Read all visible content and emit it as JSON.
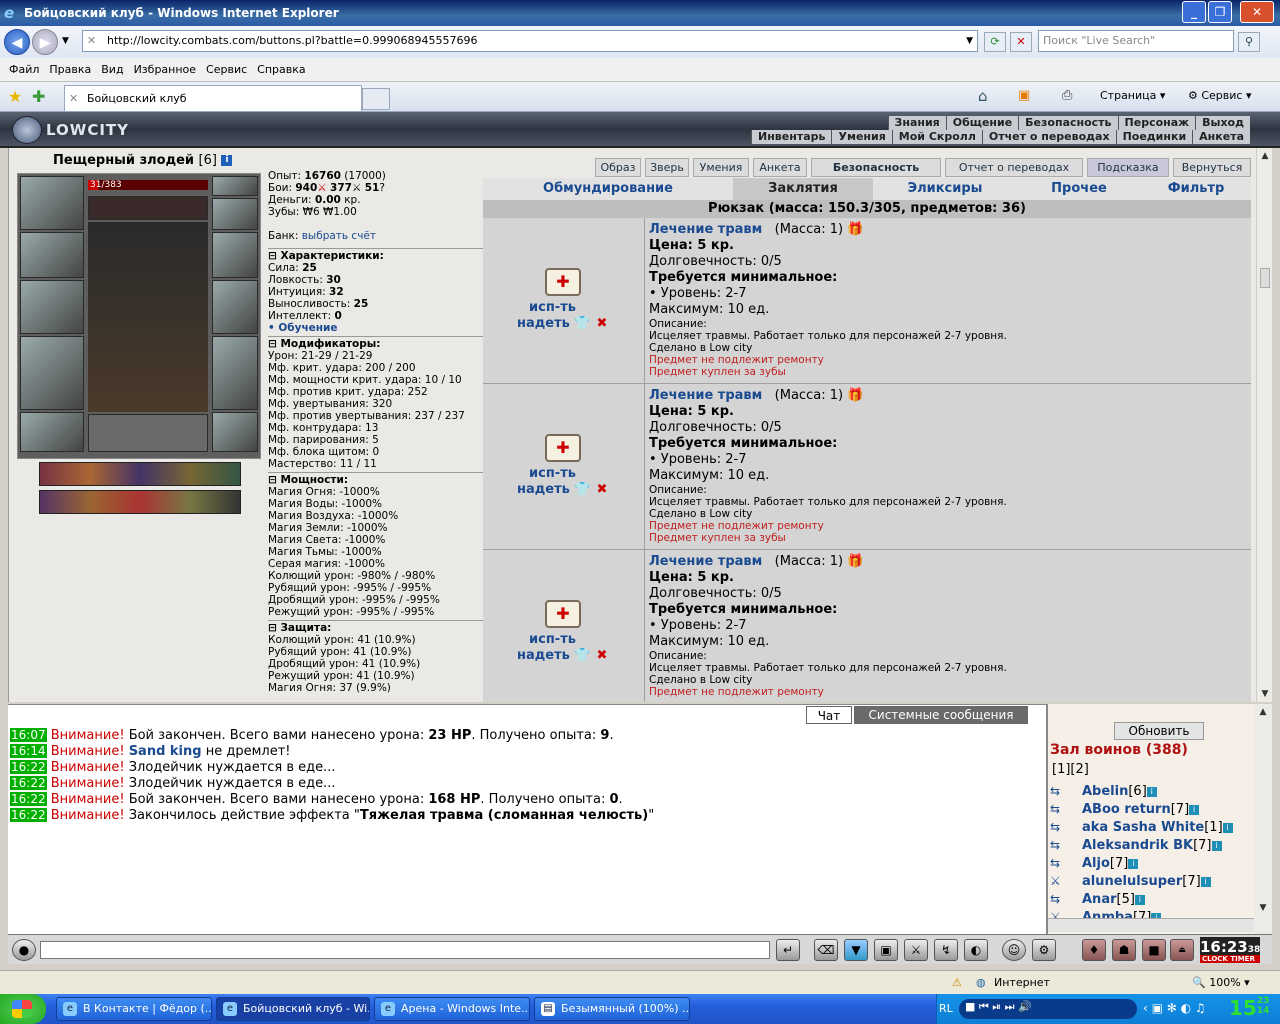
{
  "window": {
    "title": "Бойцовский клуб - Windows Internet Explorer",
    "min": "_",
    "max": "❐",
    "close": "✕"
  },
  "address": {
    "url": "http://lowcity.combats.com/buttons.pl?battle=0.999068945557696",
    "search_placeholder": "Поиск \"Live Search\""
  },
  "menu": [
    "Файл",
    "Правка",
    "Вид",
    "Избранное",
    "Сервис",
    "Справка"
  ],
  "tab": {
    "title": "Бойцовский клуб"
  },
  "toolbar_right": {
    "page": "Страница",
    "tools": "Сервис"
  },
  "game_logo": "LOWCITY",
  "top_menu_1": [
    "Знания",
    "Общение",
    "Безопасность",
    "Персонаж",
    "Выход"
  ],
  "top_menu_2": [
    "Инвентарь",
    "Умения",
    "Мой Скролл",
    "Отчет о переводах",
    "Поединки",
    "Анкета"
  ],
  "character": {
    "name": "Пещерный злодей",
    "level": "[6]",
    "info": "i",
    "hp_text": "31/383",
    "hp_fraction": 0.081
  },
  "stats": {
    "exp": {
      "label": "Опыт:",
      "value": "16760",
      "next": "(17000)"
    },
    "fights": {
      "label": "Бои:",
      "wins": "940",
      "losses": "377",
      "draws": "51"
    },
    "money": {
      "label": "Деньги:",
      "value": "0.00",
      "unit": "кр."
    },
    "teeth": {
      "label": "Зубы:",
      "value": "₩6 ₩1.00"
    },
    "bank": {
      "label": "Банк:",
      "link": "выбрать счёт"
    },
    "chars_title": "Характеристики:",
    "chars": [
      [
        "Сила:",
        "25"
      ],
      [
        "Ловкость:",
        "30"
      ],
      [
        "Интуиция:",
        "32"
      ],
      [
        "Выносливость:",
        "25"
      ],
      [
        "Интеллект:",
        "0"
      ]
    ],
    "training": "• Обучение",
    "mods_title": "Модификаторы:",
    "mods": [
      "Урон: 21-29 / 21-29",
      "Мф. крит. удара: 200 / 200",
      "Мф. мощности крит. удара: 10 / 10",
      "Мф. против крит. удара: 252",
      "Мф. увертывания: 320",
      "Мф. против увертывания: 237 / 237",
      "Мф. контрудара: 13",
      "Мф. парирования: 5",
      "Мф. блока щитом: 0",
      "Мастерство: 11 / 11"
    ],
    "power_title": "Мощности:",
    "power": [
      "Магия Огня: -1000%",
      "Магия Воды: -1000%",
      "Магия Воздуха: -1000%",
      "Магия Земли: -1000%",
      "Магия Света: -1000%",
      "Магия Тьмы: -1000%",
      "Серая магия: -1000%",
      "Колющий урон: -980% / -980%",
      "Рубящий урон: -995% / -995%",
      "Дробящий урон: -995% / -995%",
      "Режущий урон: -995% / -995%"
    ],
    "defense_title": "Защита:",
    "defense": [
      "Колющий урон: 41 (10.9%)",
      "Рубящий урон: 41 (10.9%)",
      "Дробящий урон: 41 (10.9%)",
      "Режущий урон: 41 (10.9%)",
      "Магия Огня: 37 (9.9%)"
    ]
  },
  "action_buttons": [
    "Образ",
    "Зверь",
    "Умения",
    "Анкета",
    "Безопасность",
    "Отчет о переводах",
    "Подсказка",
    "Вернуться"
  ],
  "inv_tabs": [
    "Обмундирование",
    "Заклятия",
    "Эликсиры",
    "Прочее",
    "Фильтр"
  ],
  "backpack": "Рюкзак (масса: 150.3/305, предметов: 36)",
  "item": {
    "name": "Лечение травм",
    "mass": "(Масса: 1)",
    "price": "Цена: 5 кр.",
    "durability": "Долговечность: 0/5",
    "req_title": "Требуется минимальное:",
    "req_level": "• Уровень: 2-7",
    "max": "Максимум: 10 ед.",
    "desc_title": "Описание:",
    "desc": "Исцеляет травмы. Работает только для персонажей 2-7 уровня.",
    "made": "Сделано в Low city",
    "no_repair": "Предмет не подлежит ремонту",
    "bought": "Предмет куплен за зубы",
    "use": "исп-ть",
    "wear": "надеть"
  },
  "chat_tabs": [
    "Чат",
    "Системные сообщения"
  ],
  "chat": [
    {
      "time": "16:07",
      "warn": "Внимание!",
      "pre": "Бой закончен. Всего вами нанесено урона: ",
      "b1": "23 HP",
      "mid": ". Получено опыта: ",
      "b2": "9",
      "post": "."
    },
    {
      "time": "16:14",
      "warn": "Внимание!",
      "name": "Sand king",
      "post": " не дремлет!"
    },
    {
      "time": "16:22",
      "warn": "Внимание!",
      "pre": "Злодейчик нуждается в еде..."
    },
    {
      "time": "16:22",
      "warn": "Внимание!",
      "pre": "Злодейчик нуждается в еде..."
    },
    {
      "time": "16:22",
      "warn": "Внимание!",
      "pre": "Бой закончен. Всего вами нанесено урона: ",
      "b1": "168 HP",
      "mid": ". Получено опыта: ",
      "b2": "0",
      "post": "."
    },
    {
      "time": "16:22",
      "warn": "Внимание!",
      "pre": "Закончилось действие эффекта \"",
      "b1": "Тяжелая травма (сломанная челюсть)",
      "post": "\""
    }
  ],
  "side": {
    "refresh": "Обновить",
    "hall": "Зал воинов (388)",
    "pages": "[1][2]",
    "players": [
      {
        "name": "Abelin",
        "lvl": "[6]"
      },
      {
        "name": "ABoo return",
        "lvl": "[7]"
      },
      {
        "name": "aka Sasha White",
        "lvl": "[1]"
      },
      {
        "name": "Aleksandrik BK",
        "lvl": "[7]"
      },
      {
        "name": "Aljo",
        "lvl": "[7]"
      },
      {
        "name": "alunelulsuper",
        "lvl": "[7]"
      },
      {
        "name": "Anar",
        "lvl": "[5]"
      },
      {
        "name": "Anmba",
        "lvl": "[7]"
      }
    ]
  },
  "clock": {
    "time": "16:23",
    "sec": "38",
    "clock_label": "CLOCK",
    "timer_label": "TIMER"
  },
  "status": {
    "zone": "Интернет",
    "zoom": "100%"
  },
  "taskbar": {
    "tasks": [
      "В Контакте | Фёдор (...",
      "Бойцовский клуб - Wi...",
      "Арена - Windows Inte...",
      "Безымянный (100%) ..."
    ],
    "lang": "RL",
    "time": "15",
    "time_small": "23 14"
  }
}
